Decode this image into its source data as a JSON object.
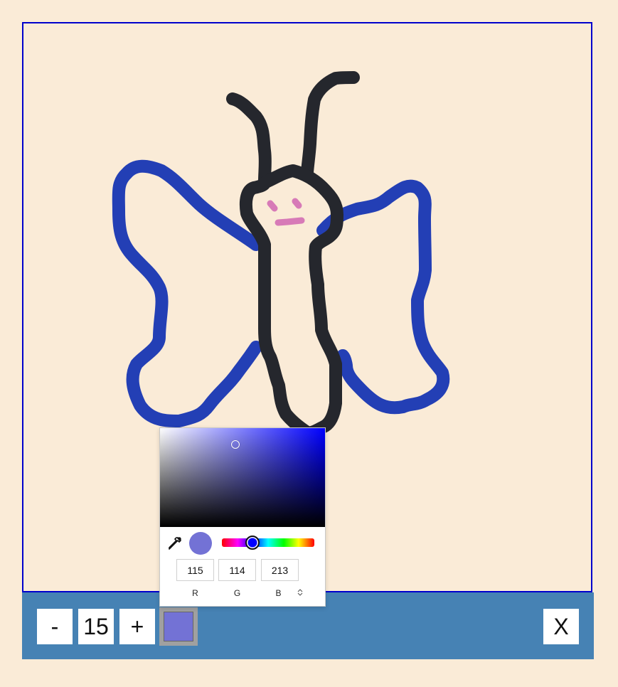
{
  "toolbar": {
    "minus_label": "-",
    "brush_size": "15",
    "plus_label": "+",
    "close_label": "X",
    "current_color": "#7372d5"
  },
  "color_picker": {
    "r_value": "115",
    "g_value": "114",
    "b_value": "213",
    "r_label": "R",
    "g_label": "G",
    "b_label": "B",
    "hue_color": "#0000ff",
    "preview_color": "#7372d5",
    "mode_toggle_icon": "chevron-up-down-icon",
    "eyedropper_icon": "eyedropper-icon"
  },
  "drawing": {
    "wing_color": "#233fb5",
    "body_color": "#25272d",
    "face_color": "#d77ab7"
  },
  "colors": {
    "page_background": "#faebd7",
    "canvas_border": "#0000cc",
    "toolbar_background": "#4682b4"
  }
}
